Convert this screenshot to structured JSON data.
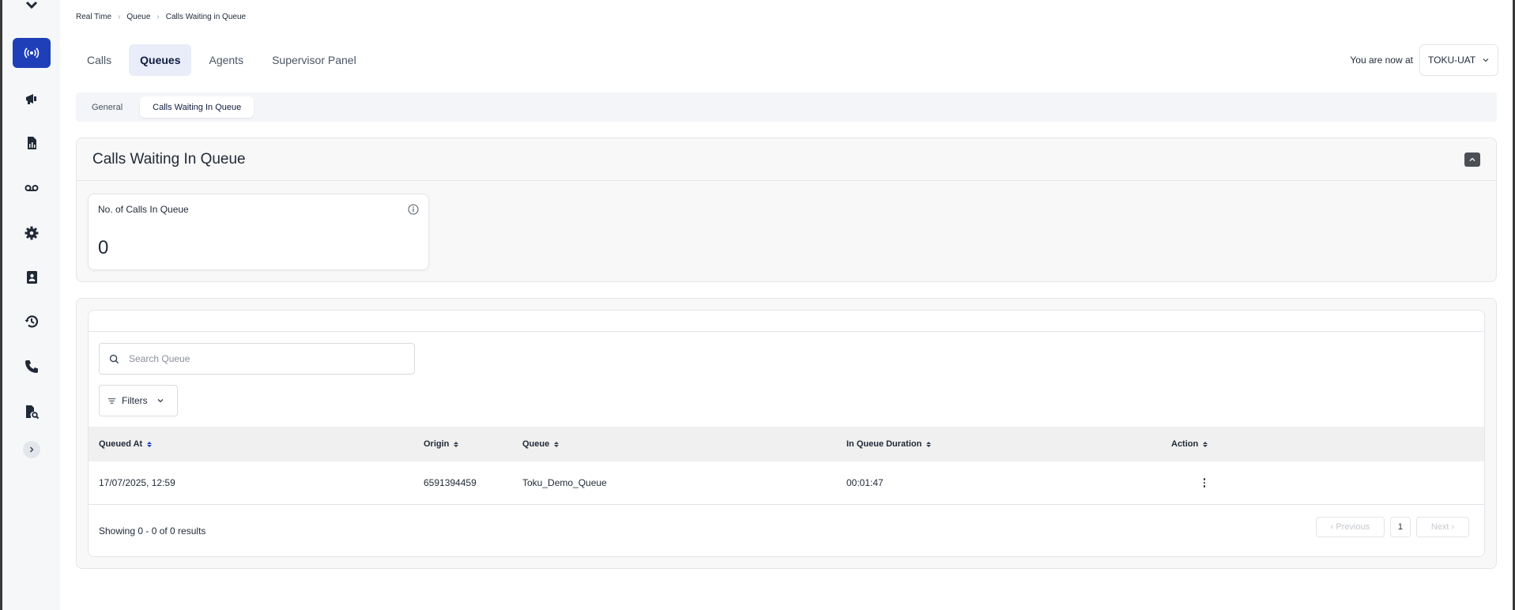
{
  "breadcrumb": [
    "Real Time",
    "Queue",
    "Calls Waiting in Queue"
  ],
  "tabs": [
    {
      "label": "Calls",
      "active": false
    },
    {
      "label": "Queues",
      "active": true
    },
    {
      "label": "Agents",
      "active": false
    },
    {
      "label": "Supervisor Panel",
      "active": false
    }
  ],
  "env": {
    "label": "You are now at",
    "value": "TOKU-UAT"
  },
  "subtabs": [
    {
      "label": "General",
      "active": false
    },
    {
      "label": "Calls Waiting In Queue",
      "active": true
    }
  ],
  "summary": {
    "title": "Calls Waiting In Queue",
    "stat_label": "No. of Calls In Queue",
    "stat_value": "0"
  },
  "search": {
    "placeholder": "Search Queue"
  },
  "filters_label": "Filters",
  "table": {
    "columns": [
      "Queued At",
      "Origin",
      "Queue",
      "In Queue Duration",
      "Action"
    ],
    "rows": [
      {
        "queued_at": "17/07/2025, 12:59",
        "origin": "6591394459",
        "queue": "Toku_Demo_Queue",
        "duration": "00:01:47"
      }
    ]
  },
  "pagination": {
    "showing": "Showing 0 - 0 of 0 results",
    "prev": "‹ Previous",
    "page": "1",
    "next": "Next ›"
  },
  "sidebar_icons": [
    "logo-icon",
    "realtime-icon",
    "campaign-icon",
    "reports-icon",
    "voicemail-icon",
    "settings-icon",
    "contacts-icon",
    "history-icon",
    "phone-icon",
    "audit-icon"
  ],
  "colors": {
    "accent": "#1e3fb8",
    "active_tab_bg": "#e8edf9",
    "header_bg": "#f0f0f0"
  }
}
